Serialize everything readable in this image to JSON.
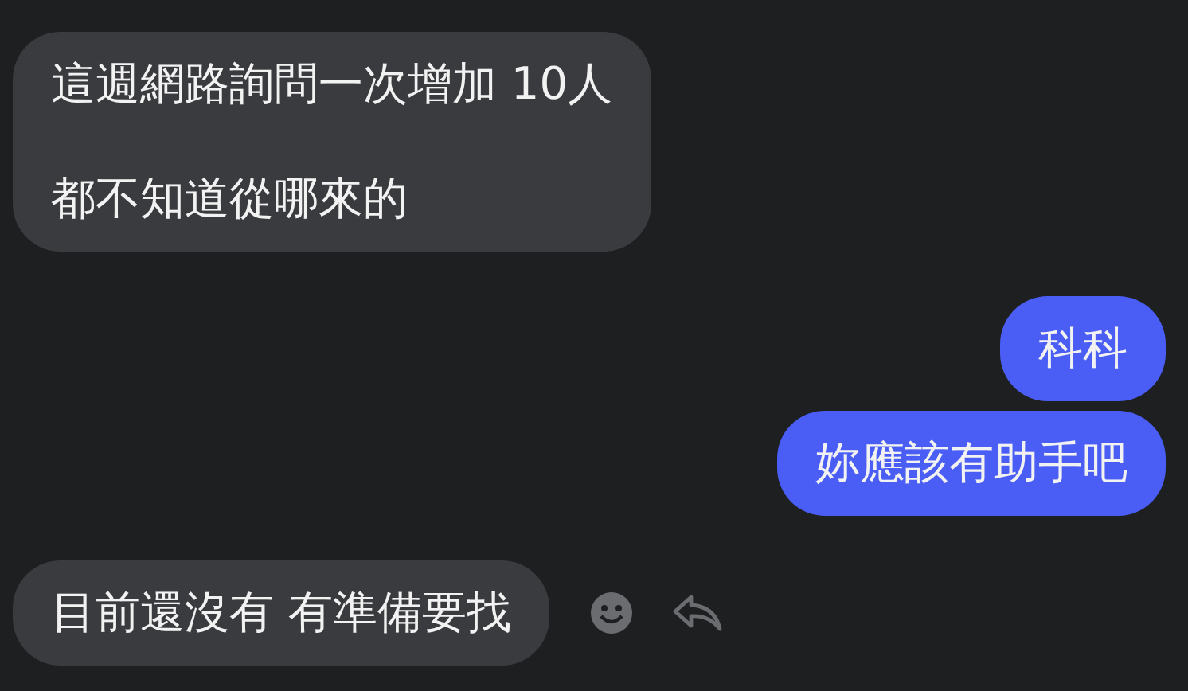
{
  "messages": [
    {
      "kind": "incoming",
      "lines": [
        "這週網路詢問一次增加 10人",
        "都不知道從哪來的"
      ],
      "actions": false
    },
    {
      "kind": "outgoing",
      "lines": [
        "科科"
      ],
      "actions": false
    },
    {
      "kind": "outgoing",
      "lines": [
        "妳應該有助手吧"
      ],
      "actions": false
    },
    {
      "kind": "incoming",
      "lines": [
        "目前還沒有 有準備要找"
      ],
      "actions": true
    }
  ]
}
